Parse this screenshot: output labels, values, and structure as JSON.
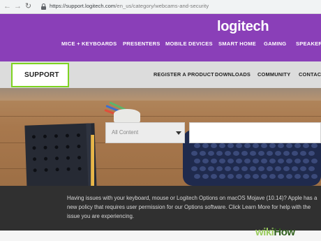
{
  "browser": {
    "url_host": "https://support.logitech.com",
    "url_path": "/en_us/category/webcams-and-security"
  },
  "header": {
    "logo": "logitech",
    "nav": [
      {
        "label": "MICE + KEYBOARDS"
      },
      {
        "label": "PRESENTERS"
      },
      {
        "label": "MOBILE DEVICES"
      },
      {
        "label": "SMART HOME"
      },
      {
        "label": "GAMING"
      },
      {
        "label": "SPEAKERS"
      }
    ]
  },
  "support_bar": {
    "title": "SUPPORT",
    "nav": [
      {
        "label": "REGISTER A PRODUCT"
      },
      {
        "label": "DOWNLOADS"
      },
      {
        "label": "COMMUNITY"
      },
      {
        "label": "CONTACT"
      }
    ]
  },
  "search": {
    "category_selected": "All Content",
    "query_value": ""
  },
  "notice": {
    "text": "Having issues with your keyboard, mouse or Logitech Options on macOS Mojave (10.14)? Apple has a new policy that requires user permission for our Options software. Click Learn More for help with the issue you are experiencing."
  },
  "watermark": {
    "wiki": "wiki",
    "how": "How"
  },
  "colors": {
    "brand_purple": "#8a3fb8",
    "highlight_green": "#7ed321",
    "notice_bg": "#303030"
  },
  "icons": [
    "back-arrow-icon",
    "forward-arrow-icon",
    "reload-icon",
    "lock-icon",
    "dropdown-caret-icon"
  ]
}
